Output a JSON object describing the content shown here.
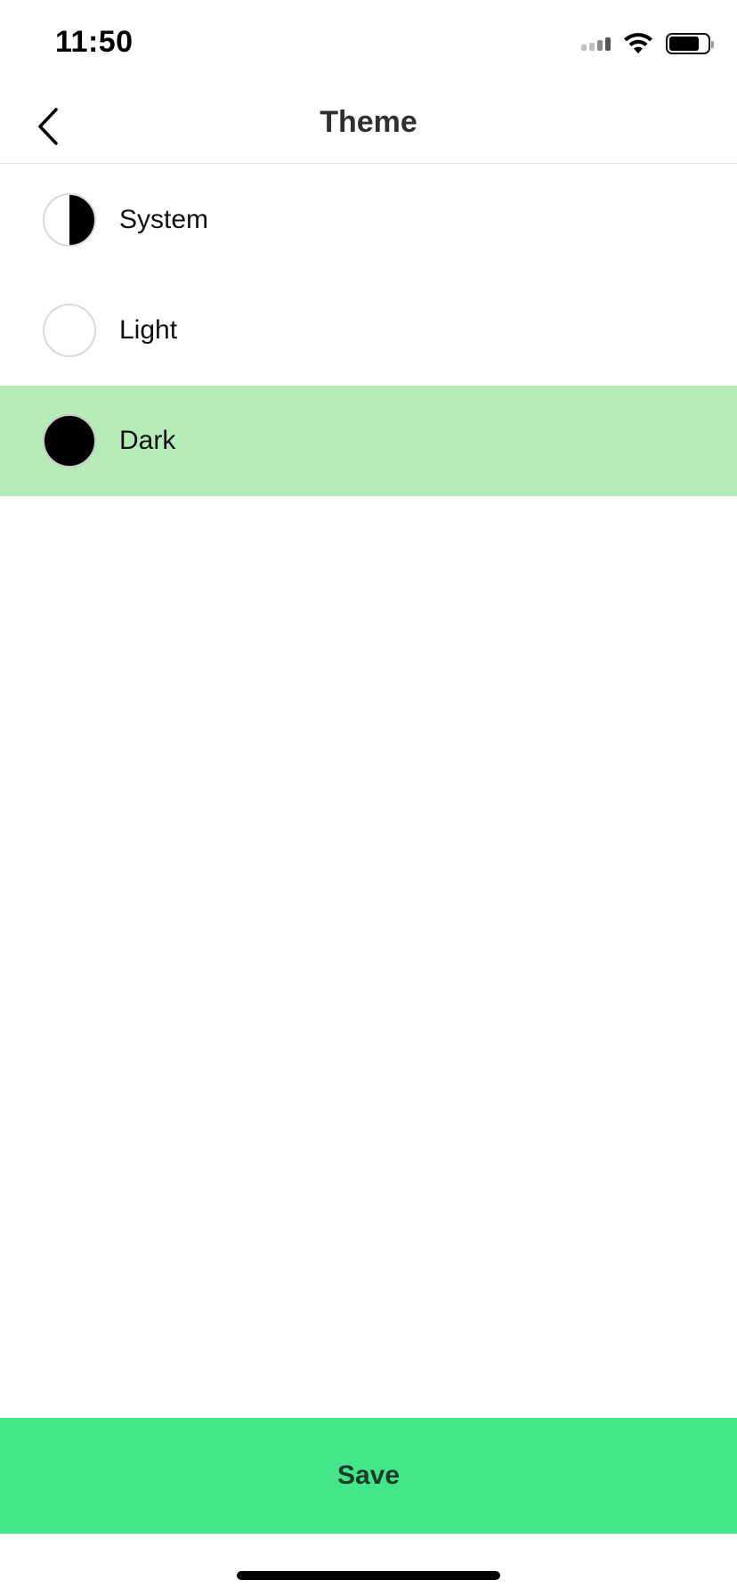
{
  "status_bar": {
    "time": "11:50"
  },
  "nav": {
    "title": "Theme"
  },
  "themes": [
    {
      "label": "System",
      "swatch": "half-black-white"
    },
    {
      "label": "Light",
      "swatch": "white"
    },
    {
      "label": "Dark",
      "swatch": "black",
      "selected": true
    }
  ],
  "footer": {
    "save_label": "Save"
  },
  "colors": {
    "selected_row": "#b4ebb6",
    "save_button": "#43e789",
    "save_text": "#1f3a2a"
  }
}
